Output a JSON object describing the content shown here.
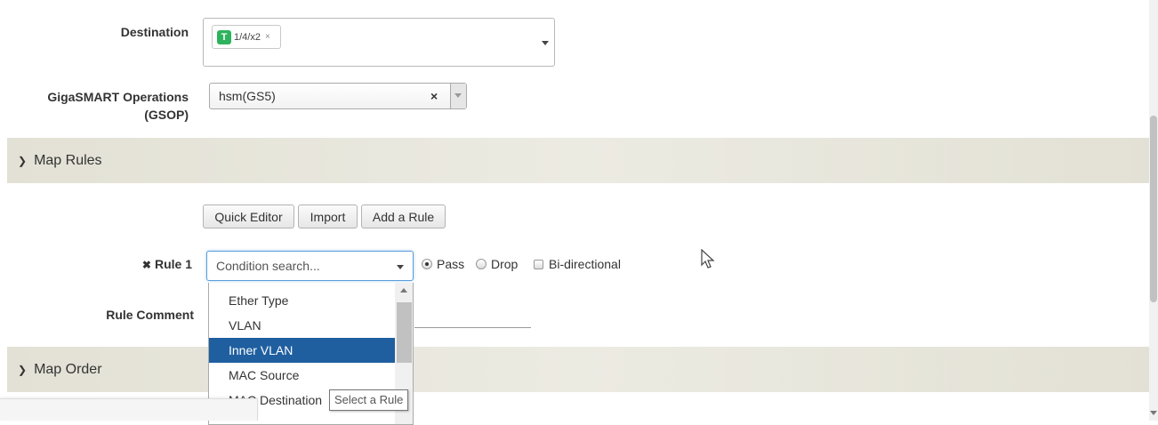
{
  "destination": {
    "label": "Destination",
    "token_badge": "T",
    "token_value": "1/4/x2",
    "token_remove": "×"
  },
  "gsop": {
    "label_line1": "GigaSMART Operations",
    "label_line2": "(GSOP)",
    "value": "hsm(GS5)",
    "clear": "×"
  },
  "map_rules": {
    "title": "Map Rules",
    "buttons": {
      "quick_editor": "Quick Editor",
      "import": "Import",
      "add_rule": "Add a Rule"
    },
    "rule": {
      "remove_icon": "✖",
      "label": "Rule 1",
      "condition_placeholder": "Condition search...",
      "pass": "Pass",
      "drop": "Drop",
      "bidirectional": "Bi-directional",
      "selected_action": "Pass"
    },
    "rule_comment_label": "Rule Comment",
    "dropdown_options": [
      "Ether Type",
      "VLAN",
      "Inner VLAN",
      "MAC Source",
      "MAC Destination"
    ],
    "highlighted_option": "Inner VLAN",
    "tooltip": "Select a Rule"
  },
  "map_order": {
    "title": "Map Order"
  },
  "colors": {
    "section_bar": "#e5e3d8",
    "highlight": "#1f5fa0",
    "token_badge": "#2db35d"
  }
}
